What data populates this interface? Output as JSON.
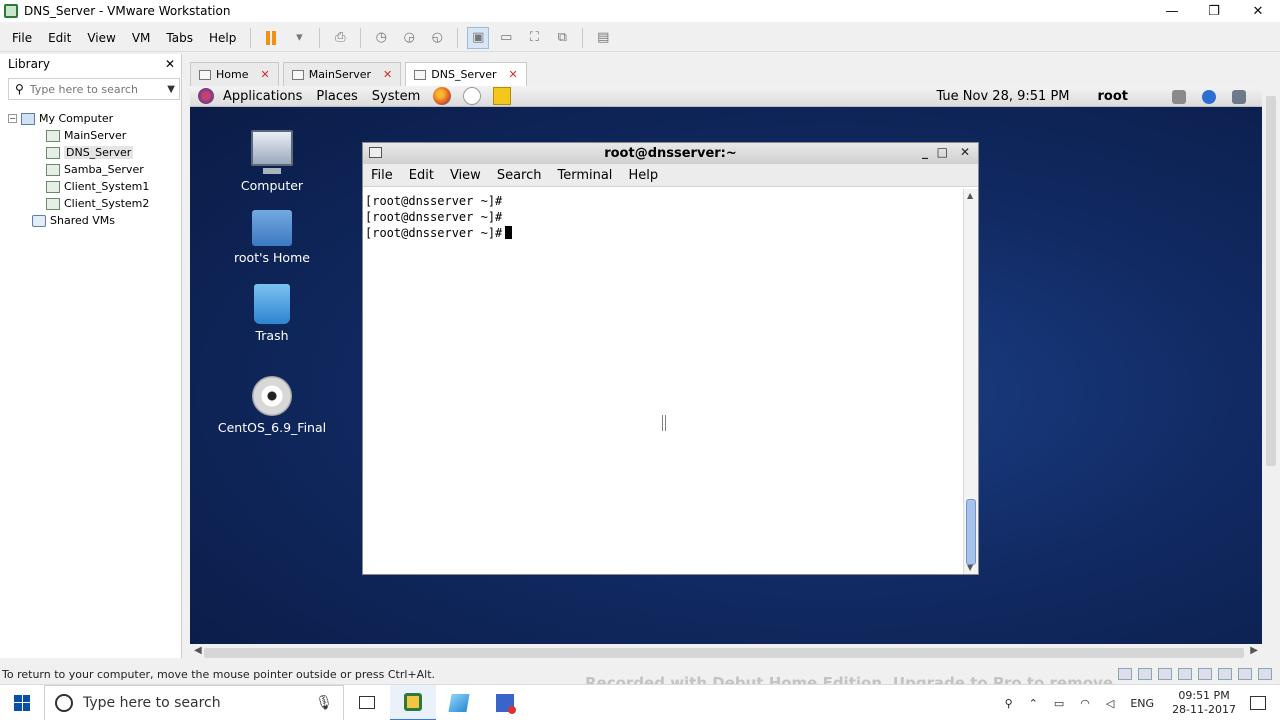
{
  "window": {
    "title": "DNS_Server - VMware Workstation",
    "controls": {
      "minimize": "—",
      "restore": "❐",
      "close": "✕"
    }
  },
  "menubar": {
    "items": [
      "File",
      "Edit",
      "View",
      "VM",
      "Tabs",
      "Help"
    ],
    "accent_pause": "#f29111"
  },
  "library": {
    "title": "Library",
    "close": "✕",
    "search_placeholder": "Type here to search",
    "tree": {
      "root": "My Computer",
      "vms": [
        "MainServer",
        "DNS_Server",
        "Samba_Server",
        "Client_System1",
        "Client_System2"
      ],
      "selected": "DNS_Server",
      "shared": "Shared VMs"
    }
  },
  "tabs": [
    {
      "label": "Home",
      "close": "✕"
    },
    {
      "label": "MainServer",
      "close": "✕"
    },
    {
      "label": "DNS_Server",
      "close": "✕",
      "active": true
    }
  ],
  "guest": {
    "panel": {
      "applications": "Applications",
      "places": "Places",
      "system": "System",
      "clock": "Tue Nov 28,  9:51 PM",
      "user": "root"
    },
    "desktop_icons": [
      "Computer",
      "root's Home",
      "Trash",
      "CentOS_6.9_Final"
    ],
    "terminal": {
      "title": "root@dnsserver:~",
      "controls": {
        "minimize": "_",
        "maximize": "□",
        "close": "✕"
      },
      "menu": [
        "File",
        "Edit",
        "View",
        "Search",
        "Terminal",
        "Help"
      ],
      "lines": [
        "[root@dnsserver ~]#",
        "[root@dnsserver ~]#",
        "[root@dnsserver ~]#"
      ]
    },
    "background_color": "#112a63"
  },
  "statusbar": {
    "text": "To return to your computer, move the mouse pointer outside or press Ctrl+Alt."
  },
  "taskbar": {
    "search_placeholder": "Type here to search",
    "language": "ENG",
    "time": "09:51 PM",
    "date": "28-11-2017"
  },
  "watermark": "Recorded with Debut Home Edition. Upgrade to Pro to remove"
}
